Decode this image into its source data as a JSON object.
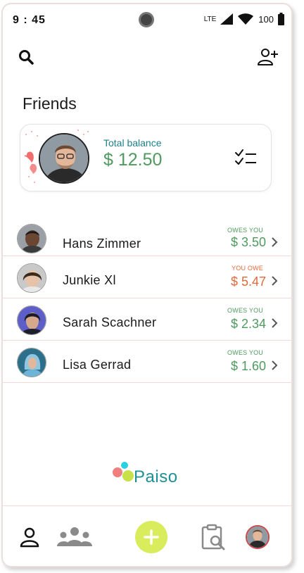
{
  "status_bar": {
    "time": "9 : 45",
    "network": "LTE",
    "battery": "100"
  },
  "header": {
    "search_icon": "search-icon",
    "add_friend_icon": "add-user-icon"
  },
  "page_title": "Friends",
  "balance": {
    "label": "Total balance",
    "amount": "$ 12.50",
    "action_icon": "checklist-icon"
  },
  "friends": [
    {
      "name": "Hans Zimmer",
      "status": "OWES YOU",
      "amount": "$ 3.50",
      "direction": "owes-you"
    },
    {
      "name": "Junkie Xl",
      "status": "YOU OWE",
      "amount": "$ 5.47",
      "direction": "you-owe"
    },
    {
      "name": "Sarah Scachner",
      "status": "OWES YOU",
      "amount": "$ 2.34",
      "direction": "owes-you"
    },
    {
      "name": "Lisa Gerrad",
      "status": "OWES YOU",
      "amount": "$ 1.60",
      "direction": "owes-you"
    }
  ],
  "logo": {
    "text": "Paiso"
  },
  "colors": {
    "teal": "#1f8f96",
    "green": "#4f9a5e",
    "orange": "#e06a3a",
    "lime": "#d8ec5c",
    "pink": "#f08080",
    "cyan": "#2ad0e0"
  },
  "bottom_nav": {
    "items": [
      "profile-icon",
      "groups-icon",
      "add-icon",
      "activity-icon",
      "avatar"
    ]
  }
}
